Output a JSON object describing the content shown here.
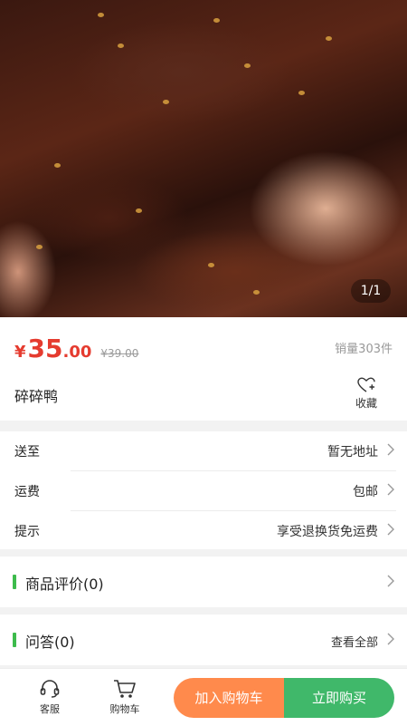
{
  "gallery": {
    "counter": "1/1"
  },
  "product": {
    "currency": "¥",
    "price_int": "35",
    "price_dec": ".00",
    "original_price": "¥39.00",
    "sales": "销量303件",
    "name": "碎碎鸭",
    "favorite_label": "收藏"
  },
  "info": {
    "delivery_label": "送至",
    "delivery_value": "暂无地址",
    "shipping_label": "运费",
    "shipping_value": "包邮",
    "tip_label": "提示",
    "tip_value": "享受退换货免运费"
  },
  "reviews": {
    "title": "商品评价(0)"
  },
  "qa": {
    "title": "问答(0)",
    "more": "查看全部"
  },
  "bottom_bar": {
    "service_label": "客服",
    "cart_label": "购物车",
    "add_to_cart": "加入购物车",
    "buy_now": "立即购买"
  },
  "colors": {
    "price": "#e53b2f",
    "accent_green": "#3dbb4c",
    "add_to_cart_bg": "#ff8a4c",
    "buy_now_bg": "#40b86a"
  }
}
